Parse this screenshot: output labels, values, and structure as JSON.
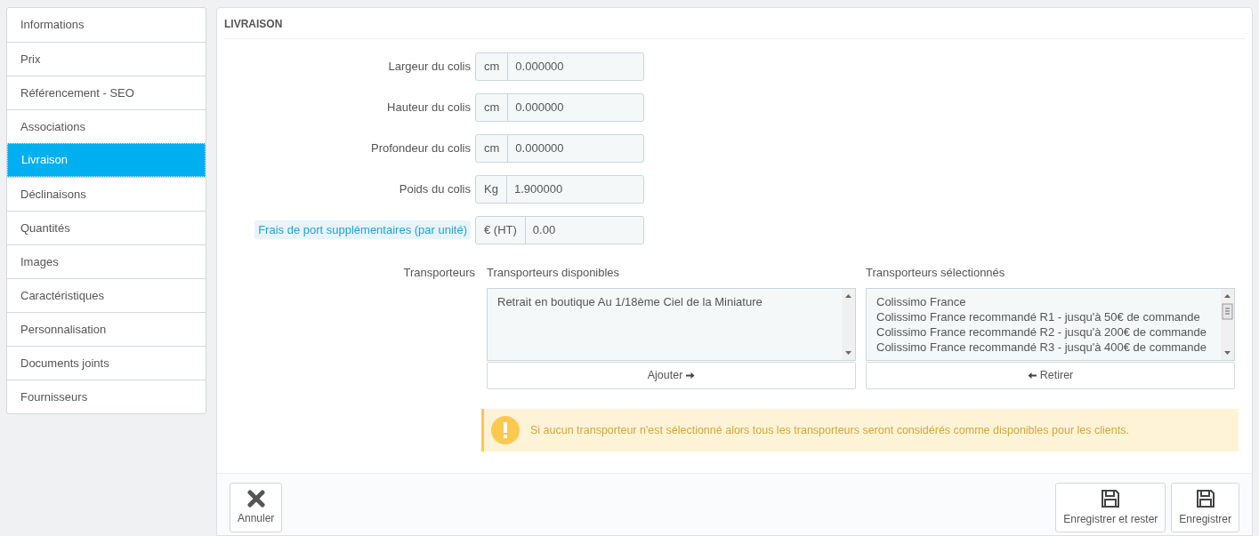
{
  "sidebar": {
    "items": [
      {
        "label": "Informations",
        "selected": false
      },
      {
        "label": "Prix",
        "selected": false
      },
      {
        "label": "Référencement - SEO",
        "selected": false
      },
      {
        "label": "Associations",
        "selected": false
      },
      {
        "label": "Livraison",
        "selected": true
      },
      {
        "label": "Déclinaisons",
        "selected": false
      },
      {
        "label": "Quantités",
        "selected": false
      },
      {
        "label": "Images",
        "selected": false
      },
      {
        "label": "Caractéristiques",
        "selected": false
      },
      {
        "label": "Personnalisation",
        "selected": false
      },
      {
        "label": "Documents joints",
        "selected": false
      },
      {
        "label": "Fournisseurs",
        "selected": false
      }
    ]
  },
  "panel": {
    "title": "LIVRAISON",
    "fields": [
      {
        "label": "Largeur du colis",
        "addon": "cm",
        "value": "0.000000",
        "hint": false
      },
      {
        "label": "Hauteur du colis",
        "addon": "cm",
        "value": "0.000000",
        "hint": false
      },
      {
        "label": "Profondeur du colis",
        "addon": "cm",
        "value": "0.000000",
        "hint": false
      },
      {
        "label": "Poids du colis",
        "addon": "Kg",
        "value": "1.900000",
        "hint": false
      },
      {
        "label": "Frais de port supplémentaires (par unité)",
        "addon": "€ (HT)",
        "value": "0.00",
        "hint": true
      }
    ],
    "carriers": {
      "label": "Transporteurs",
      "available": {
        "title": "Transporteurs disponibles",
        "items": [
          "Retrait en boutique Au 1/18ème Ciel de la Miniature"
        ],
        "button": "Ajouter",
        "scroll_thumb": false
      },
      "selected": {
        "title": "Transporteurs sélectionnés",
        "items": [
          "Colissimo France",
          "Colissimo France recommandé R1 - jusqu'à 50€ de commande",
          "Colissimo France recommandé R2 - jusqu'à 200€ de commande",
          "Colissimo France recommandé R3 - jusqu'à 400€ de commande"
        ],
        "button": "Retirer",
        "scroll_thumb": true
      }
    },
    "alert": "Si aucun transporteur n'est sélectionné alors tous les transporteurs seront considérés comme disponibles pour les clients."
  },
  "footer": {
    "buttons": [
      {
        "label": "Annuler",
        "kind": "cancel"
      },
      {
        "label": "Enregistrer et rester",
        "kind": "save"
      },
      {
        "label": "Enregistrer",
        "kind": "save"
      }
    ]
  }
}
